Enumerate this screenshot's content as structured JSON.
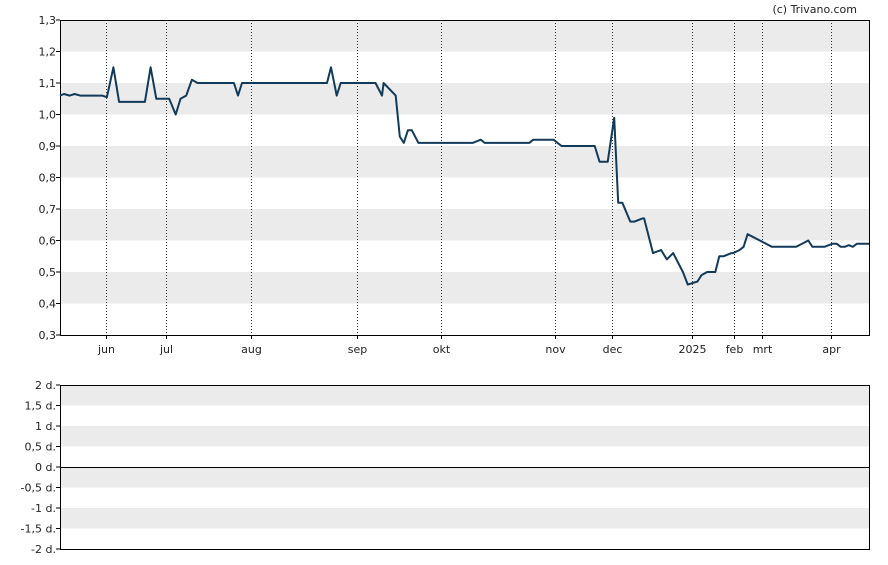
{
  "credit": "(c) Trivano.com",
  "colors": {
    "line": "#123b5a",
    "band": "#ebebeb",
    "frame": "#000000",
    "vgrid": "#333333"
  },
  "chart_data": [
    {
      "type": "line",
      "title": "",
      "xlabel": "",
      "ylabel": "",
      "ylim": [
        0.3,
        1.3
      ],
      "grid": "alternating horizontal bands, dotted vertical month lines",
      "y_ticks": [
        "1,3",
        "1,2",
        "1,1",
        "1,0",
        "0,9",
        "0,8",
        "0,7",
        "0,6",
        "0,5",
        "0,4",
        "0,3"
      ],
      "x_ticks": [
        {
          "label": "jun",
          "t": 0.0563
        },
        {
          "label": "jul",
          "t": 0.1311
        },
        {
          "label": "aug",
          "t": 0.2359
        },
        {
          "label": "sep",
          "t": 0.367
        },
        {
          "label": "okt",
          "t": 0.4706
        },
        {
          "label": "nov",
          "t": 0.6116
        },
        {
          "label": "dec",
          "t": 0.6825
        },
        {
          "label": "2025",
          "t": 0.7811
        },
        {
          "label": "feb",
          "t": 0.8335
        },
        {
          "label": "mrt",
          "t": 0.8673
        },
        {
          "label": "apr",
          "t": 0.9531
        }
      ],
      "series": [
        {
          "t": [
            0.0,
            0.005,
            0.012,
            0.018,
            0.025,
            0.04,
            0.052,
            0.058,
            0.066,
            0.073,
            0.09,
            0.105,
            0.112,
            0.119,
            0.13,
            0.135,
            0.143,
            0.149,
            0.156,
            0.163,
            0.17,
            0.176,
            0.185,
            0.215,
            0.22,
            0.225,
            0.258,
            0.33,
            0.335,
            0.342,
            0.347,
            0.354,
            0.36,
            0.39,
            0.398,
            0.4,
            0.415,
            0.42,
            0.425,
            0.43,
            0.435,
            0.443,
            0.45,
            0.47,
            0.51,
            0.52,
            0.525,
            0.53,
            0.58,
            0.585,
            0.59,
            0.61,
            0.615,
            0.62,
            0.657,
            0.661,
            0.667,
            0.677,
            0.685,
            0.69,
            0.695,
            0.705,
            0.71,
            0.72,
            0.722,
            0.733,
            0.743,
            0.75,
            0.758,
            0.77,
            0.776,
            0.788,
            0.793,
            0.8,
            0.81,
            0.815,
            0.82,
            0.83,
            0.832,
            0.84,
            0.845,
            0.85,
            0.88,
            0.885,
            0.89,
            0.905,
            0.91,
            0.925,
            0.93,
            0.945,
            0.955,
            0.96,
            0.965,
            0.97,
            0.975,
            0.98,
            0.985,
            1.0
          ],
          "values": [
            1.06,
            1.065,
            1.06,
            1.065,
            1.06,
            1.06,
            1.06,
            1.055,
            1.15,
            1.04,
            1.04,
            1.04,
            1.15,
            1.05,
            1.05,
            1.05,
            1.0,
            1.05,
            1.06,
            1.11,
            1.1,
            1.1,
            1.1,
            1.1,
            1.06,
            1.1,
            1.1,
            1.1,
            1.15,
            1.06,
            1.1,
            1.1,
            1.1,
            1.1,
            1.06,
            1.1,
            1.06,
            0.93,
            0.91,
            0.95,
            0.95,
            0.91,
            0.91,
            0.91,
            0.91,
            0.92,
            0.91,
            0.91,
            0.91,
            0.92,
            0.92,
            0.92,
            0.91,
            0.9,
            0.9,
            0.9,
            0.85,
            0.85,
            0.99,
            0.72,
            0.72,
            0.66,
            0.66,
            0.67,
            0.67,
            0.56,
            0.57,
            0.54,
            0.56,
            0.5,
            0.46,
            0.47,
            0.49,
            0.5,
            0.5,
            0.55,
            0.55,
            0.56,
            0.56,
            0.57,
            0.58,
            0.62,
            0.58,
            0.58,
            0.58,
            0.58,
            0.58,
            0.6,
            0.58,
            0.58,
            0.59,
            0.59,
            0.58,
            0.58,
            0.585,
            0.58,
            0.59,
            0.59
          ]
        }
      ]
    },
    {
      "type": "line",
      "title": "",
      "ylim": [
        -2,
        2
      ],
      "grid": "alternating horizontal bands",
      "y_ticks": [
        "2 d.",
        "1,5 d.",
        "1 d.",
        "0,5 d.",
        "0 d.",
        "-0,5 d.",
        "-1 d.",
        "-1,5 d.",
        "-2 d."
      ],
      "zero_line": 0,
      "series": []
    }
  ]
}
